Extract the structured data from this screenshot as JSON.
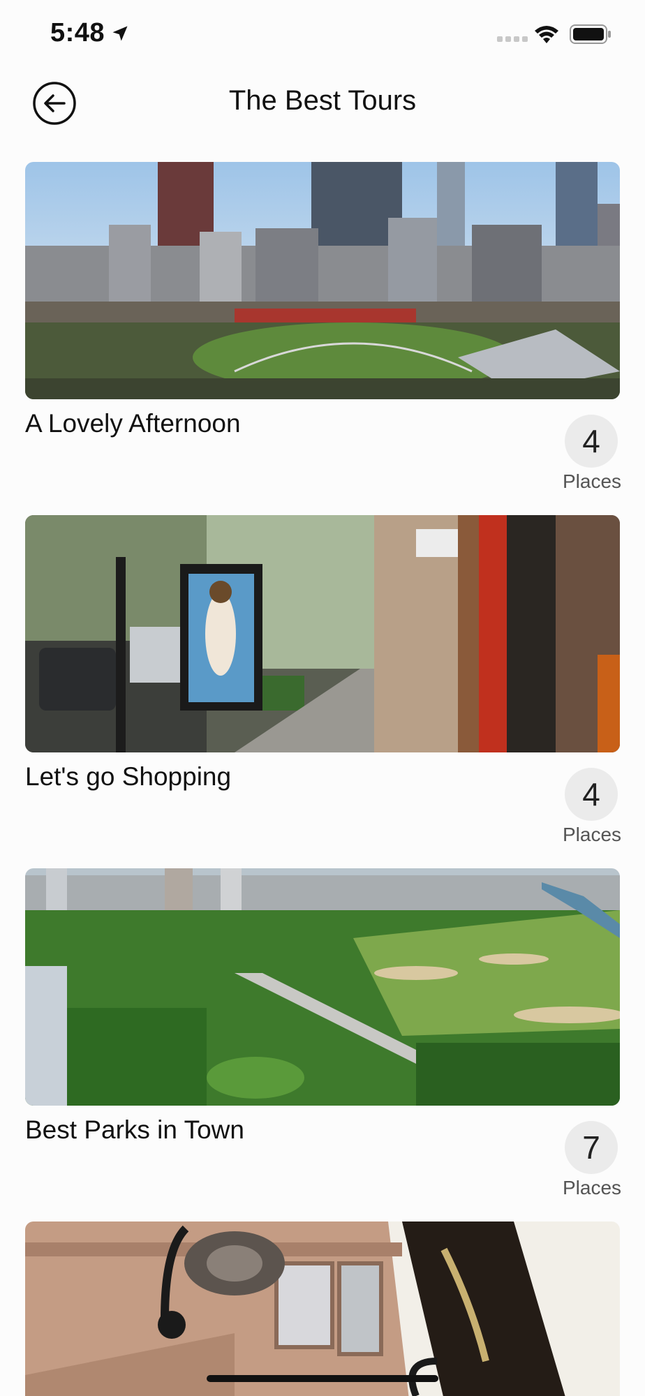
{
  "status_bar": {
    "time": "5:48",
    "icons": [
      "location-arrow-icon",
      "cellular-signal-icon",
      "wifi-icon",
      "battery-icon"
    ]
  },
  "header": {
    "title": "The Best Tours",
    "back_icon": "back-arrow-circle-icon"
  },
  "tours": [
    {
      "title": "A Lovely Afternoon",
      "places_count": "4",
      "places_label": "Places",
      "image": "city skyline with park"
    },
    {
      "title": "Let's go Shopping",
      "places_count": "4",
      "places_label": "Places",
      "image": "shopping street sidewalk"
    },
    {
      "title": "Best Parks in Town",
      "places_count": "7",
      "places_label": "Places",
      "image": "aerial view of park"
    },
    {
      "title": "",
      "places_count": "",
      "places_label": "",
      "image": "building facade with lamp"
    }
  ],
  "colors": {
    "background": "#fcfcfc",
    "badge_background": "#ebebeb",
    "text": "#111111",
    "secondary_text": "#555555"
  }
}
